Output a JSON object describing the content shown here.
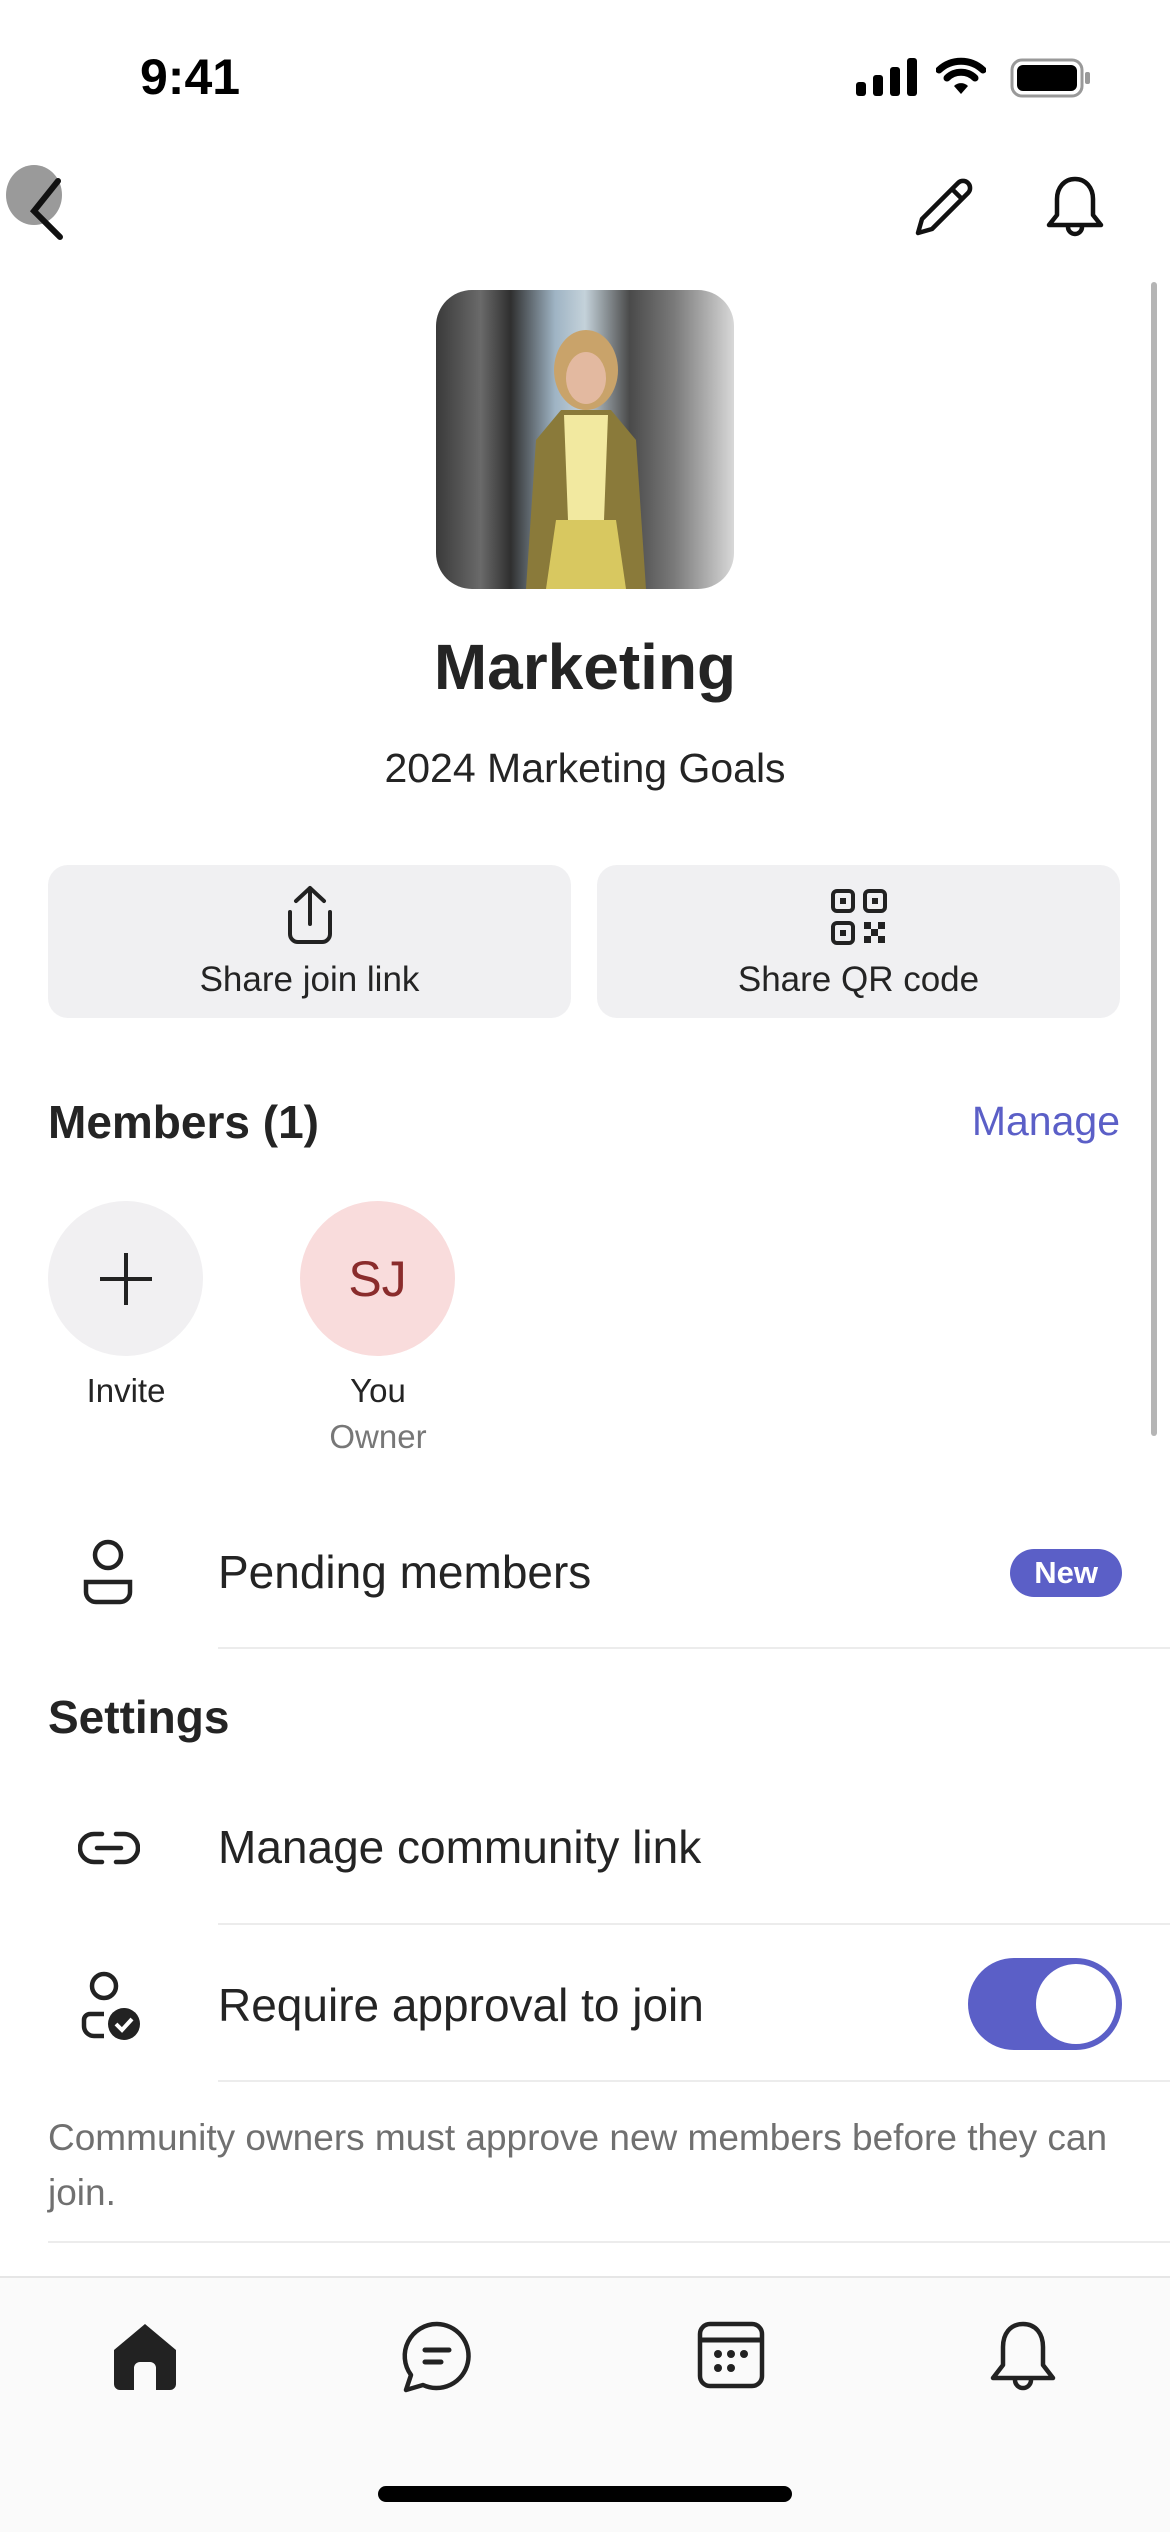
{
  "status_bar": {
    "time": "9:41"
  },
  "nav": {
    "back_icon": "chevron-left-icon",
    "edit_icon": "pencil-icon",
    "notifications_icon": "bell-icon"
  },
  "community": {
    "name": "Marketing",
    "description": "2024 Marketing Goals"
  },
  "actions": [
    {
      "label": "Share join link",
      "icon": "share-icon"
    },
    {
      "label": "Share QR code",
      "icon": "qr-code-icon"
    }
  ],
  "members": {
    "title": "Members (1)",
    "manage_label": "Manage",
    "invite": {
      "label": "Invite",
      "icon": "plus-icon"
    },
    "list": [
      {
        "initials": "SJ",
        "name": "You",
        "role": "Owner"
      }
    ]
  },
  "pending": {
    "label": "Pending members",
    "badge": "New",
    "icon": "person-icon"
  },
  "settings": {
    "title": "Settings",
    "items": [
      {
        "label": "Manage community link",
        "icon": "link-icon"
      },
      {
        "label": "Require approval to join",
        "icon": "person-check-icon",
        "toggle_on": true
      }
    ],
    "approval_description": "Community owners must approve new members before they can join."
  },
  "tabs": [
    {
      "icon": "home-icon",
      "active": true
    },
    {
      "icon": "chat-icon"
    },
    {
      "icon": "calendar-icon"
    },
    {
      "icon": "bell-icon"
    }
  ],
  "colors": {
    "accent": "#5b5fc7",
    "avatar_bg": "#f9dcdc",
    "avatar_text": "#8a2c2c",
    "button_bg": "#f0f0f2"
  }
}
